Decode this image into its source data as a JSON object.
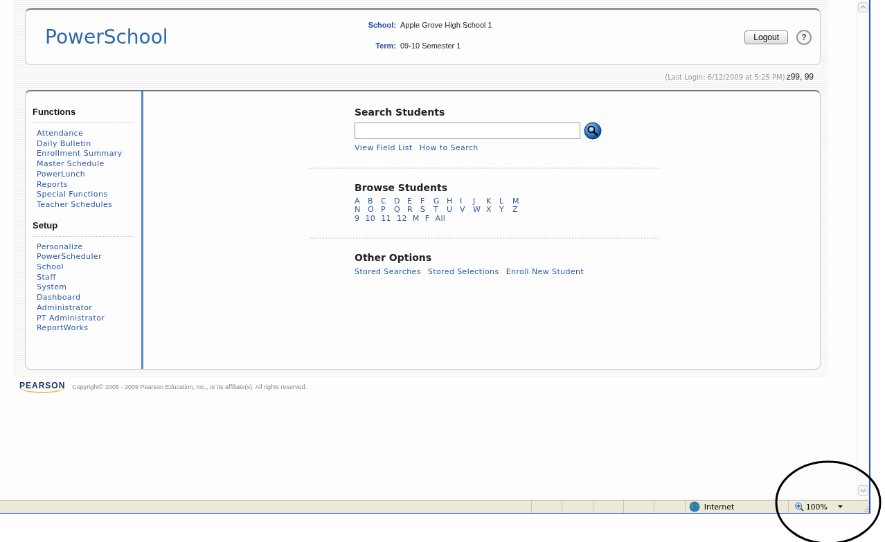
{
  "header": {
    "logo": "PowerSchool",
    "school_label": "School:",
    "school": "Apple Grove High School 1",
    "term_label": "Term:",
    "term": "09-10 Semester 1",
    "logout": "Logout",
    "help": "?"
  },
  "last_login": "(Last Login: 6/12/2009 at 5:25 PM)",
  "user": "z99, 99",
  "sidebar": [
    {
      "heading": "Functions",
      "items": [
        "Attendance",
        "Daily Bulletin",
        "Enrollment Summary",
        "Master Schedule",
        "PowerLunch",
        "Reports",
        "Special Functions",
        "Teacher Schedules"
      ]
    },
    {
      "heading": "Setup",
      "items": [
        "Personalize",
        "PowerScheduler",
        "School",
        "Staff",
        "System",
        "Dashboard",
        "Administrator",
        "PT Administrator",
        "ReportWorks"
      ]
    }
  ],
  "search": {
    "heading": "Search Students",
    "links": [
      "View Field List",
      "How to Search"
    ]
  },
  "browse": {
    "heading": "Browse Students",
    "rows": [
      [
        "A",
        "B",
        "C",
        "D",
        "E",
        "F",
        "G",
        "H",
        "I",
        "J",
        "K",
        "L",
        "M"
      ],
      [
        "N",
        "O",
        "P",
        "Q",
        "R",
        "S",
        "T",
        "U",
        "V",
        "W",
        "X",
        "Y",
        "Z"
      ],
      [
        "9",
        "10",
        "11",
        "12",
        "M",
        "F",
        "All"
      ]
    ]
  },
  "other": {
    "heading": "Other Options",
    "links": [
      "Stored Searches",
      "Stored Selections",
      "Enroll New Student"
    ]
  },
  "footer": {
    "brand": "PEARSON",
    "copyright": "Copyright© 2005 - 2009 Pearson Education, Inc., or its affiliate(s). All rights reserved."
  },
  "status_bar": {
    "zone": "Internet",
    "zoom": "100%"
  }
}
